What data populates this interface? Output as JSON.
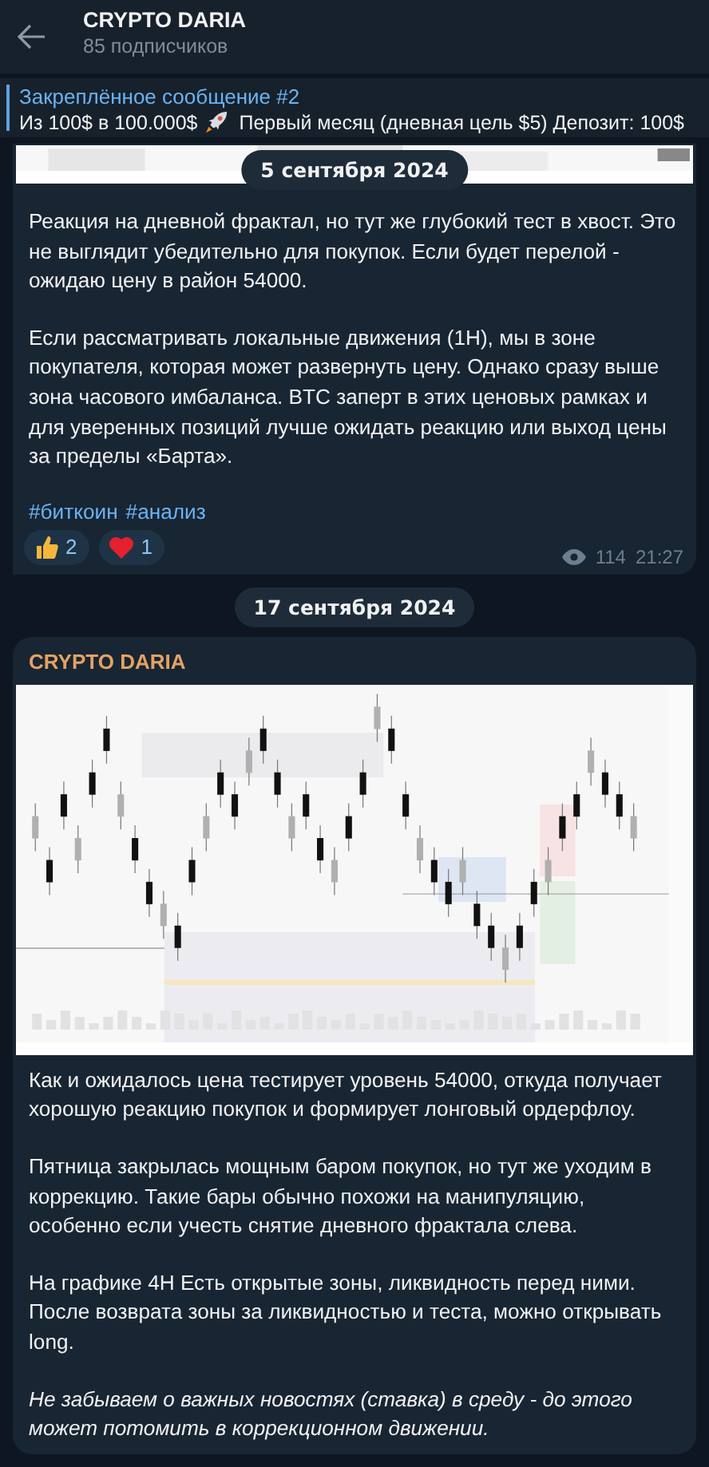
{
  "header": {
    "title": "CRYPTO DARIA",
    "subtitle": "85 подписчиков"
  },
  "pinned": {
    "title": "Закреплённое сообщение #2",
    "text_before": "Из 100$ в 100.000$",
    "text_after": "Первый месяц (дневная цель $5) Депозит: 100$"
  },
  "messages": [
    {
      "date": "5 сентября 2024",
      "image": {
        "kind": "picture"
      },
      "paragraphs": [
        {
          "kind": "plain",
          "text": "Реакция на дневной фрактал, но тут же глубокий тест в хвост. Это не выглядит убедительно для покупок. Если будет перелой - ожидаю цену в район 54000."
        },
        {
          "kind": "plain",
          "text": "Если рассматривать локальные движения (1H), мы в зоне покупателя, которая может развернуть цену. Однако сразу выше зона часового имбаланса. BTC заперт в этих ценовых рамках и для уверенных позиций лучше ожидать реакцию или выход цены за пределы «Барта»."
        },
        {
          "kind": "hashtags",
          "tags": [
            "#биткоин",
            "#анализ"
          ]
        }
      ],
      "reactions": [
        {
          "kind": "thumbs-up",
          "count": "2"
        },
        {
          "kind": "heart",
          "count": "1"
        }
      ],
      "views": "114",
      "time": "21:27"
    },
    {
      "date": "17 сентября 2024",
      "author": "CRYPTO DARIA",
      "image": {
        "kind": "picture"
      },
      "paragraphs": [
        {
          "kind": "plain",
          "text": "Как и ожидалось цена тестирует уровень 54000, откуда получает хорошую реакцию покупок и формирует лонговый ордерфлоу."
        },
        {
          "kind": "plain",
          "text": "Пятница закрылась мощным баром покупок, но тут же уходим в коррекцию. Такие бары обычно похожи на манипуляцию, особенно если учесть снятие дневного фрактала слева."
        },
        {
          "kind": "plain",
          "text": "На графике 4H Есть открытые зоны, ликвидность перед ними. После возврата зоны за ликвидностью и теста, можно открывать long."
        },
        {
          "kind": "italic",
          "text": "Не забываем о важных новостях (ставка) в среду - до этого может потомить в коррекционном движении."
        }
      ]
    }
  ]
}
